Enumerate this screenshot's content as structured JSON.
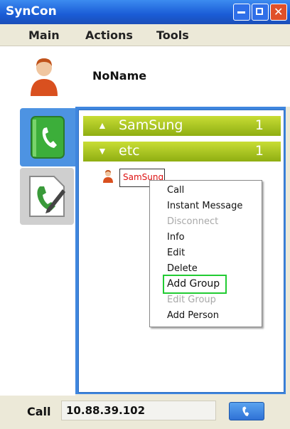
{
  "window": {
    "title": "SynCon"
  },
  "menubar": {
    "items": [
      "Main",
      "Actions",
      "Tools"
    ]
  },
  "profile": {
    "name": "NoName",
    "avatar_icon": "person-icon"
  },
  "tabs": [
    {
      "icon": "phone-book-icon",
      "selected": true
    },
    {
      "icon": "phone-document-icon",
      "selected": false
    }
  ],
  "groups": [
    {
      "name": "SamSung",
      "count": "1",
      "state": "collapsed"
    },
    {
      "name": "etc",
      "count": "1",
      "state": "expanded"
    }
  ],
  "contact": {
    "name": "SamSung",
    "icon": "person-icon"
  },
  "context_menu": {
    "items": [
      {
        "label": "Call",
        "enabled": true
      },
      {
        "label": "Instant Message",
        "enabled": true
      },
      {
        "label": "Disconnect",
        "enabled": false
      },
      {
        "label": "Info",
        "enabled": true
      },
      {
        "label": "Edit",
        "enabled": true
      },
      {
        "label": "Delete",
        "enabled": true
      },
      {
        "label": "Add Group",
        "enabled": true,
        "highlighted": true
      },
      {
        "label": "Edit Group",
        "enabled": false
      },
      {
        "label": "Add Person",
        "enabled": true
      }
    ]
  },
  "call_bar": {
    "label": "Call",
    "value": "10.88.39.102",
    "button_icon": "phone-icon"
  },
  "colors": {
    "titlebar": "#1a5cd6",
    "group_header": "#a4c021",
    "highlight_box": "#22cc33",
    "contact_text": "#dd1111"
  }
}
